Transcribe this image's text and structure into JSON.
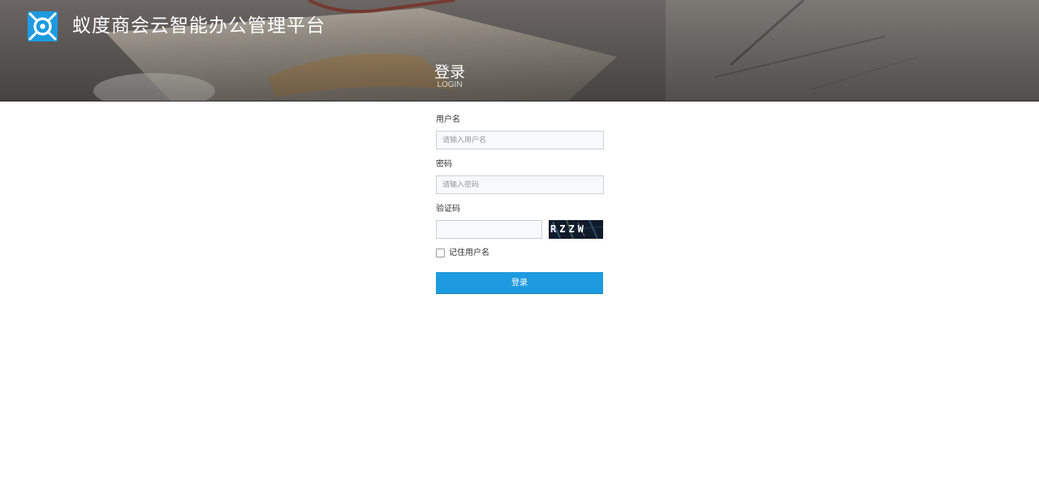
{
  "header": {
    "site_title": "蚁度商会云智能办公管理平台",
    "login_heading": "登录",
    "login_subheading": "LOGIN",
    "logo_icon": "app-logo-icon"
  },
  "form": {
    "username_label": "用户名",
    "username_placeholder": "请输入用户名",
    "username_value": "",
    "password_label": "密码",
    "password_placeholder": "请输入密码",
    "password_value": "",
    "captcha_label": "验证码",
    "captcha_value": "",
    "captcha_image_text": "RZZW",
    "remember_label": "记住用户名",
    "remember_checked": false,
    "submit_label": "登录"
  },
  "colors": {
    "accent": "#1e9be0",
    "logo": "#1e9be0"
  }
}
